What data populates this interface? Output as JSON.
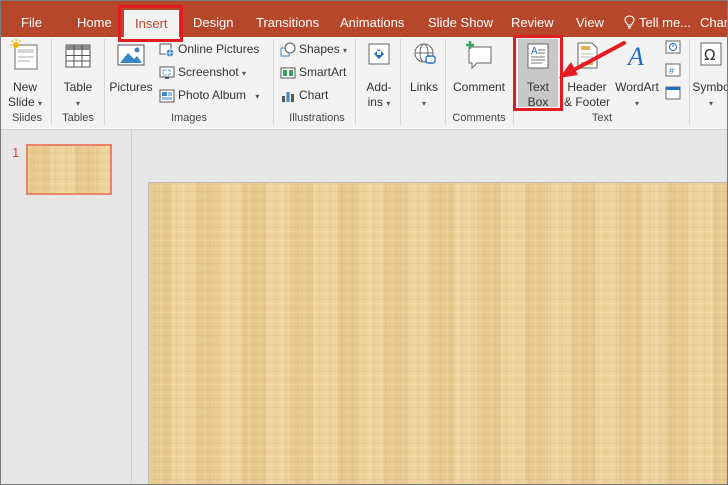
{
  "tabs": [
    {
      "label": "File"
    },
    {
      "label": "Home"
    },
    {
      "label": "Insert"
    },
    {
      "label": "Design"
    },
    {
      "label": "Transitions"
    },
    {
      "label": "Animations"
    },
    {
      "label": "Slide Show"
    },
    {
      "label": "Review"
    },
    {
      "label": "View"
    },
    {
      "label": "Tell me..."
    },
    {
      "label": "Chan"
    }
  ],
  "active_tab": "Insert",
  "ribbon": {
    "slides": {
      "new_slide_l1": "New",
      "new_slide_l2": "Slide",
      "group": "Slides"
    },
    "tables": {
      "table": "Table",
      "group": "Tables"
    },
    "images": {
      "pictures": "Pictures",
      "online_pictures": "Online Pictures",
      "screenshot": "Screenshot",
      "photo_album": "Photo Album",
      "group": "Images"
    },
    "illustrations": {
      "shapes": "Shapes",
      "smartart": "SmartArt",
      "chart": "Chart",
      "group": "Illustrations"
    },
    "addins": {
      "l1": "Add-",
      "l2": "ins"
    },
    "links": {
      "label": "Links"
    },
    "comments": {
      "comment": "Comment",
      "group": "Comments"
    },
    "text": {
      "textbox_l1": "Text",
      "textbox_l2": "Box",
      "header_l1": "Header",
      "header_l2": "& Footer",
      "wordart": "WordArt",
      "group": "Text"
    },
    "symbols": {
      "label": "Symbo"
    }
  },
  "thumbnails": {
    "slide_number": "1"
  },
  "colors": {
    "accent": "#b7472a",
    "highlight": "#e31b23",
    "slide_bg": "#ebcf95"
  },
  "icons": [
    "lightbulb-icon",
    "new-slide-icon",
    "table-icon",
    "pictures-icon",
    "online-pictures-icon",
    "screenshot-icon",
    "photo-album-icon",
    "shapes-icon",
    "smartart-icon",
    "chart-icon",
    "addins-icon",
    "links-icon",
    "comment-icon",
    "textbox-icon",
    "header-footer-icon",
    "wordart-icon",
    "equation-icon",
    "symbol-icon",
    "red-arrow-icon"
  ]
}
